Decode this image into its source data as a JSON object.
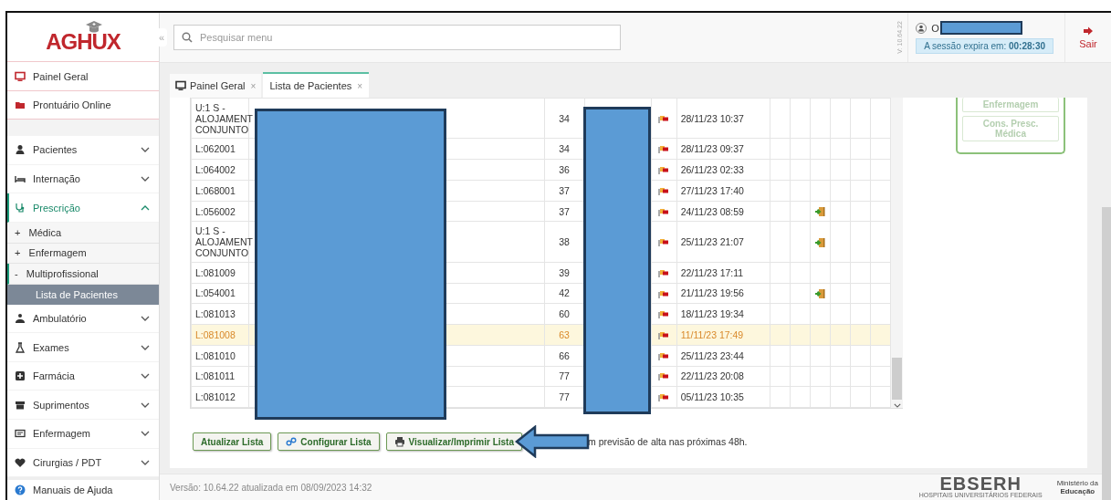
{
  "header": {
    "logo": "AGHUX",
    "collapse": "«",
    "search": {
      "placeholder": "Pesquisar menu"
    },
    "version": "V: 10.64.22",
    "user": "O",
    "session": "A sessão expira em: **00:28:30**",
    "logout": "Sair"
  },
  "sidebar": {
    "top_links": [
      {
        "label": "Painel Geral"
      },
      {
        "label": "Prontuário Online"
      }
    ],
    "menu": [
      {
        "label": "Pacientes",
        "expanded": false
      },
      {
        "label": "Internação",
        "expanded": false
      },
      {
        "label": "Prescrição",
        "expanded": true,
        "children": [
          {
            "label": "Médica",
            "prefix": "+",
            "expanded": false
          },
          {
            "label": "Enfermagem",
            "prefix": "+",
            "expanded": false
          },
          {
            "label": "Multiprofissional",
            "prefix": "-",
            "expanded": true,
            "children": [
              {
                "label": "Lista de Pacientes",
                "selected": true
              }
            ]
          }
        ]
      },
      {
        "label": "Ambulatório",
        "expanded": false
      },
      {
        "label": "Exames",
        "expanded": false
      },
      {
        "label": "Farmácia",
        "expanded": false
      },
      {
        "label": "Suprimentos",
        "expanded": false
      },
      {
        "label": "Enfermagem",
        "expanded": false
      },
      {
        "label": "Cirurgias / PDT",
        "expanded": false
      }
    ],
    "help": "Manuais de Ajuda"
  },
  "tabs": [
    {
      "label": "Painel Geral",
      "close": "×",
      "selected": false
    },
    {
      "label": "Lista de Pacientes",
      "close": "×",
      "selected": true
    }
  ],
  "table": {
    "rows": [
      {
        "local": "U:1 S -\nALOJAMENT\nCONJUNTO",
        "number": "34",
        "date": "28/11/23 10:37",
        "alta": false,
        "selected": false
      },
      {
        "local": "L:062001",
        "number": "34",
        "date": "28/11/23 09:37",
        "alta": false,
        "selected": false
      },
      {
        "local": "L:064002",
        "number": "36",
        "date": "26/11/23 02:33",
        "alta": false,
        "selected": false
      },
      {
        "local": "L:068001",
        "number": "37",
        "date": "27/11/23 17:40",
        "alta": false,
        "selected": false
      },
      {
        "local": "L:056002",
        "number": "37",
        "date": "24/11/23 08:59",
        "alta": true,
        "selected": false
      },
      {
        "local": "U:1 S -\nALOJAMENT\nCONJUNTO",
        "number": "38",
        "date": "25/11/23 21:07",
        "alta": true,
        "selected": false
      },
      {
        "local": "L:081009",
        "number": "39",
        "date": "22/11/23 17:11",
        "alta": false,
        "selected": false
      },
      {
        "local": "L:054001",
        "number": "42",
        "date": "21/11/23 19:56",
        "alta": true,
        "selected": false
      },
      {
        "local": "L:081013",
        "number": "60",
        "date": "18/11/23 19:34",
        "alta": false,
        "selected": false
      },
      {
        "local": "L:081008",
        "number": "63",
        "date": "11/11/23 17:49",
        "alta": false,
        "selected": true
      },
      {
        "local": "L:081010",
        "number": "66",
        "date": "25/11/23 23:44",
        "alta": false,
        "selected": false
      },
      {
        "local": "L:081011",
        "number": "77",
        "date": "22/11/23 20:08",
        "alta": false,
        "selected": false
      },
      {
        "local": "L:081012",
        "number": "77",
        "date": "05/11/23 10:35",
        "alta": false,
        "selected": false
      }
    ]
  },
  "side_buttons": [
    {
      "label": "Enfermagem",
      "disabled": true
    },
    {
      "label": "Cons. Presc. Médica",
      "disabled": true
    }
  ],
  "actions": [
    {
      "label": "Atualizar Lista"
    },
    {
      "label": "Configurar Lista"
    },
    {
      "label": "Visualizar/Imprimir Lista"
    }
  ],
  "legend": "m previsão de alta nas próximas 48h.",
  "footer": {
    "version": "Versão: 10.64.22 atualizada em 08/09/2023 14:32",
    "brand": "EBSERH",
    "brand_sub": "HOSPITAIS UNIVERSITÁRIOS FEDERAIS",
    "ministry": "Ministério da",
    "ministry_bold": "Educação"
  }
}
